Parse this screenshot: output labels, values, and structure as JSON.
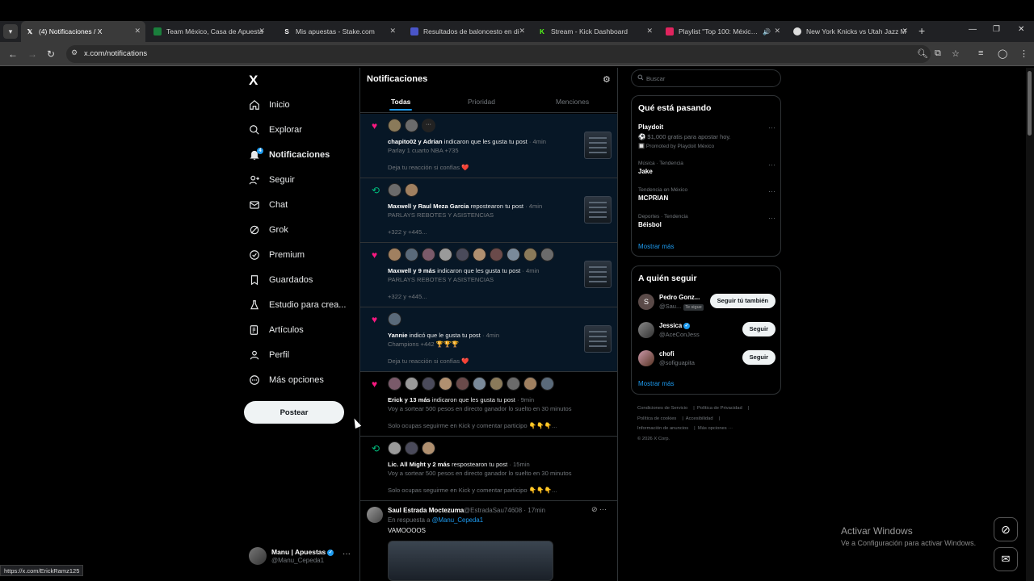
{
  "browser": {
    "tabs": [
      {
        "title": "(4) Notificaciones / X",
        "active": true,
        "favicon": "x-icon"
      },
      {
        "title": "Team México, Casa de Apuesta",
        "favicon": "bet-icon"
      },
      {
        "title": "Mis apuestas - Stake.com",
        "favicon": "stake-icon"
      },
      {
        "title": "Resultados de baloncesto en di",
        "favicon": "scores-icon"
      },
      {
        "title": "Stream - Kick Dashboard",
        "favicon": "kick-icon"
      },
      {
        "title": "Playlist \"Top 100: México\" e",
        "favicon": "music-icon"
      },
      {
        "title": "New York Knicks vs Utah Jazz M",
        "favicon": "sports-icon"
      }
    ],
    "url": "x.com/notifications",
    "status_url": "https://x.com/ErickRamz125"
  },
  "sidebar": {
    "logo": "X",
    "notif_count": "4",
    "items": [
      {
        "label": "Inicio",
        "icon": "home-icon"
      },
      {
        "label": "Explorar",
        "icon": "search-icon"
      },
      {
        "label": "Notificaciones",
        "icon": "bell-icon"
      },
      {
        "label": "Seguir",
        "icon": "person-add-icon"
      },
      {
        "label": "Chat",
        "icon": "mail-icon"
      },
      {
        "label": "Grok",
        "icon": "grok-icon"
      },
      {
        "label": "Premium",
        "icon": "premium-icon"
      },
      {
        "label": "Guardados",
        "icon": "bookmark-icon"
      },
      {
        "label": "Estudio para crea...",
        "icon": "flask-icon"
      },
      {
        "label": "Artículos",
        "icon": "article-icon"
      },
      {
        "label": "Perfil",
        "icon": "person-icon"
      },
      {
        "label": "Más opciones",
        "icon": "more-circle-icon"
      }
    ],
    "post_button": "Postear",
    "account": {
      "name": "Manu | Apuestas",
      "handle": "@Manu_Cepeda1"
    }
  },
  "main": {
    "title": "Notificaciones",
    "tabs": [
      "Todas",
      "Prioridad",
      "Menciones"
    ],
    "notifications": [
      {
        "type": "like",
        "avatars": 2,
        "actors": "chapito02 y Adrian",
        "action": " indicaron que les gusta tu post",
        "time": " · 4min",
        "sub": "Parlay 1 cuarto NBA +735",
        "extra": "Deja tu reacción si confías ❤️",
        "unread": true
      },
      {
        "type": "repost",
        "avatars": 2,
        "actors": "Maxwell y Raul Meza Garcia",
        "action": " repostearon tu post",
        "time": " · 4min",
        "sub": "PARLAYS REBOTES Y ASISTENCIAS",
        "extra": "+322 y +445...",
        "unread": true
      },
      {
        "type": "like",
        "avatars": 10,
        "actors": "Maxwell y 9 más",
        "action": " indicaron que les gusta tu post",
        "time": " · 4min",
        "sub": "PARLAYS REBOTES Y ASISTENCIAS",
        "extra": "+322 y +445...",
        "unread": true
      },
      {
        "type": "like",
        "avatars": 1,
        "actors": "Yannie",
        "action": " indicó que le gusta tu post",
        "time": " · 4min",
        "sub": "Champions +442 🏆🏆🏆",
        "extra": "Deja tu reacción si confías ❤️",
        "unread": true
      },
      {
        "type": "like",
        "avatars": 10,
        "actors": "Erick y 13 más",
        "action": " indicaron que les gusta tu post",
        "time": " · 9min",
        "sub": "Voy a sortear 500 pesos en directo ganador lo suelto en 30 minutos",
        "extra": "Solo ocupas seguirme en Kick y comentar participo 👇👇👇...",
        "unread": false
      },
      {
        "type": "repost",
        "avatars": 3,
        "actors": "Lic. All Might y 2 más",
        "action": " respostearon tu post",
        "time": " · 15min",
        "sub": "Voy a sortear 500 pesos en directo ganador lo suelto en 30 minutos",
        "extra": "Solo ocupas seguirme en Kick y comentar participo 👇👇👇...",
        "unread": false
      }
    ],
    "reply": {
      "name": "Saul Estrada Moctezuma",
      "handle": "@EstradaSau74608 · 17min",
      "reply_prefix": "En respuesta a ",
      "reply_to": "@Manu_Cepeda1",
      "body": "VAMOOOOS"
    }
  },
  "right": {
    "search_placeholder": "Buscar",
    "trends_title": "Qué está pasando",
    "promo": {
      "name": "Playdoit",
      "text": "⚽ $1,000 gratis para apostar hoy.",
      "by": "🔲 Promoted by Playdoit México"
    },
    "trends": [
      {
        "context": "Música · Tendencia",
        "name": "Jake"
      },
      {
        "context": "Tendencia en México",
        "name": "MCPRIAN"
      },
      {
        "context": "Deportes · Tendencia",
        "name": "Béisbol"
      }
    ],
    "show_more": "Mostrar más",
    "follow_title": "A quién seguir",
    "follow": [
      {
        "name": "Pedro Gonz...",
        "handle": "@Sau...",
        "tag": "Te sigue",
        "button": "Seguir tú también",
        "initial": "S"
      },
      {
        "name": "Jessica",
        "handle": "@AceConJess",
        "button": "Seguir",
        "verified": true
      },
      {
        "name": "chofi",
        "handle": "@sofiguapita",
        "button": "Seguir"
      }
    ],
    "footer": [
      "Condiciones de Servicio",
      "Política de Privacidad",
      "Política de cookies",
      "Accesibilidad",
      "Información de anuncios",
      "Más opciones ···",
      "© 2026 X Corp."
    ]
  },
  "windows": {
    "activate_title": "Activar Windows",
    "activate_sub": "Ve a Configuración para activar Windows."
  },
  "colors": {
    "accent": "#1d9bf0",
    "like": "#f91880",
    "repost": "#00ba7c",
    "bg": "#000000"
  }
}
